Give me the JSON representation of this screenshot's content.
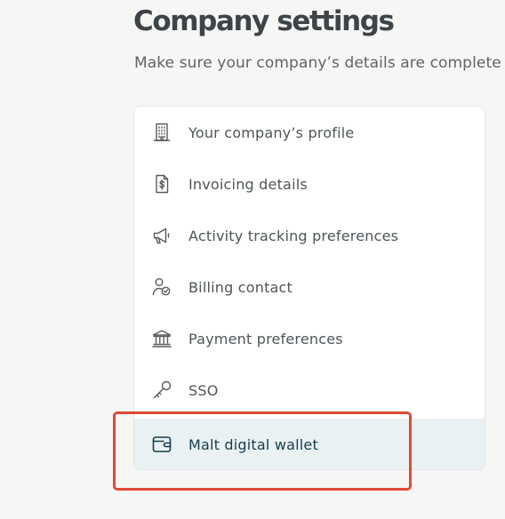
{
  "header": {
    "title": "Company settings",
    "subtitle": "Make sure your company’s details are complete"
  },
  "menu": {
    "items": [
      {
        "label": "Your company’s profile",
        "icon": "building-icon"
      },
      {
        "label": "Invoicing details",
        "icon": "invoice-icon"
      },
      {
        "label": "Activity tracking preferences",
        "icon": "megaphone-icon"
      },
      {
        "label": "Billing contact",
        "icon": "user-check-icon"
      },
      {
        "label": "Payment preferences",
        "icon": "bank-icon"
      },
      {
        "label": "SSO",
        "icon": "key-icon"
      },
      {
        "label": "Malt digital wallet",
        "icon": "wallet-icon",
        "active": true
      }
    ]
  },
  "colors": {
    "active_background": "#e9f1f2",
    "active_text": "#163d4e",
    "highlight_border": "#de4a36"
  }
}
